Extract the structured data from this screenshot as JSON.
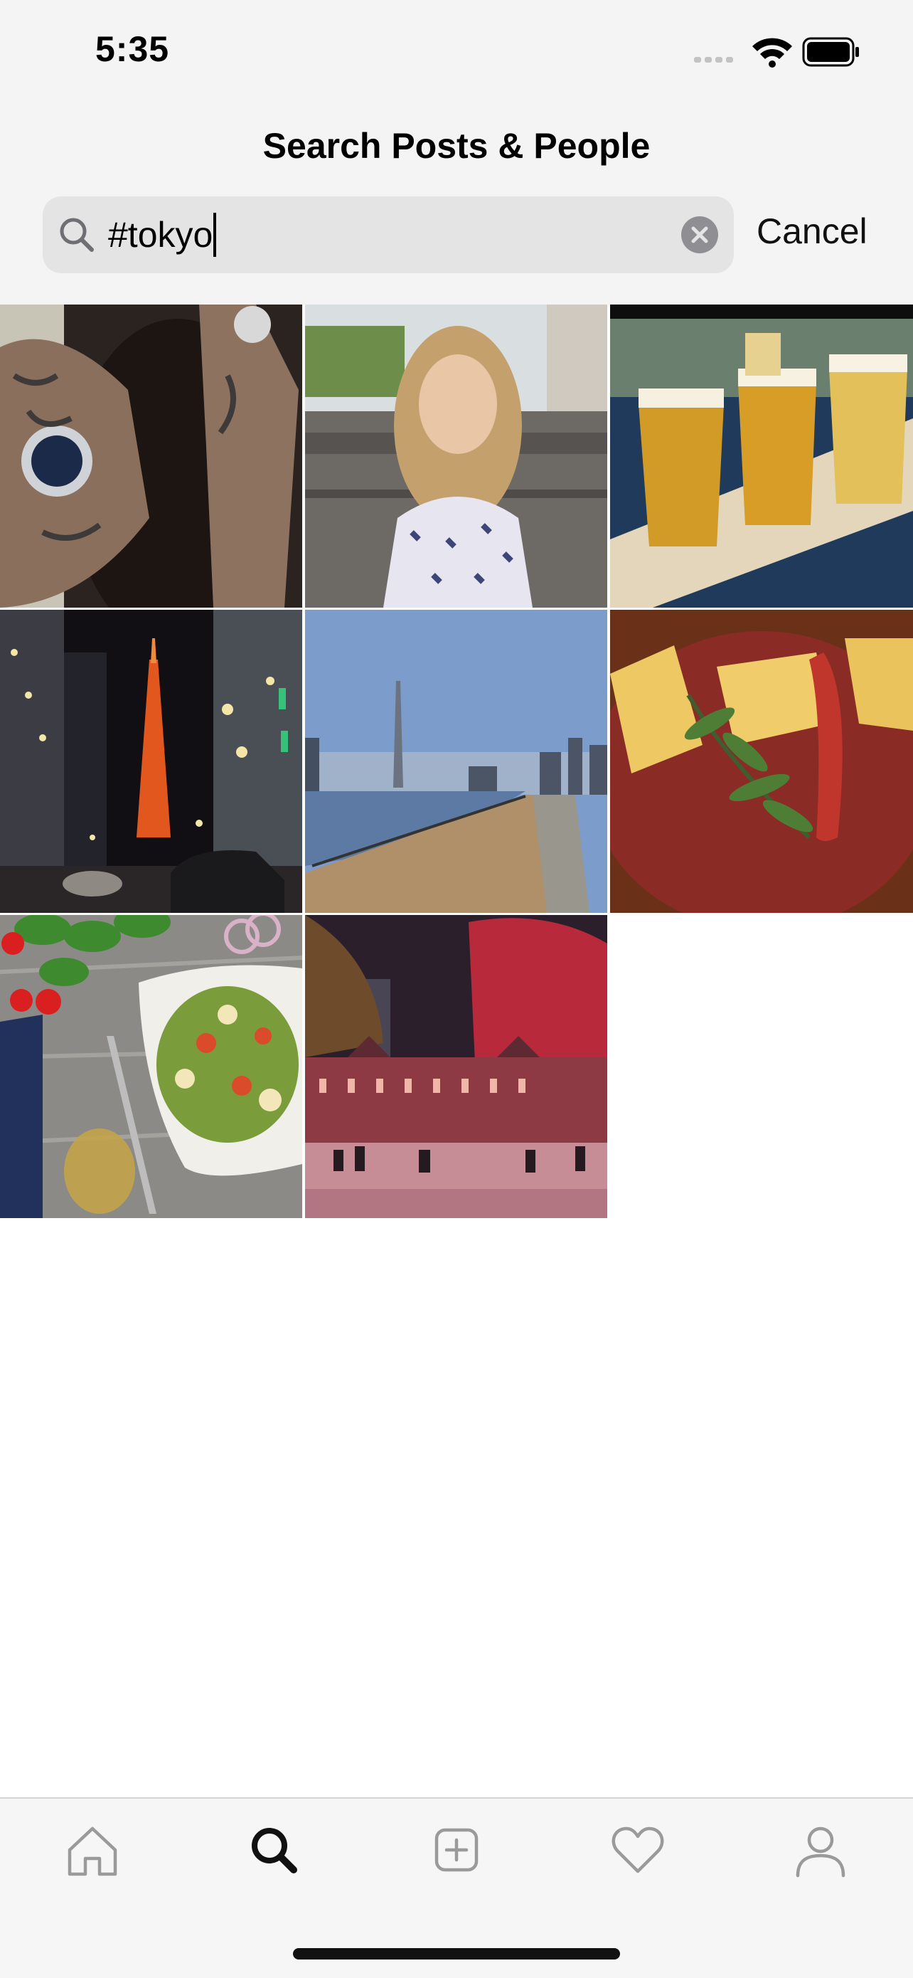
{
  "status_bar": {
    "time": "5:35",
    "signal_icon": "signal-dots-icon",
    "wifi_icon": "wifi-icon",
    "battery_icon": "battery-icon"
  },
  "header": {
    "title": "Search Posts & People"
  },
  "search": {
    "value": "#tokyo",
    "search_icon": "magnifier-icon",
    "clear_icon": "clear-x-icon",
    "cancel_label": "Cancel"
  },
  "results": [
    {
      "name": "post-tattooed-hands-watch"
    },
    {
      "name": "post-blonde-woman-portrait"
    },
    {
      "name": "post-beer-flight"
    },
    {
      "name": "post-tokyo-tower-night-street"
    },
    {
      "name": "post-skytree-river"
    },
    {
      "name": "post-tamagoyaki-plate"
    },
    {
      "name": "post-salad-bowl"
    },
    {
      "name": "post-tokyo-station-illuminated"
    }
  ],
  "tab_bar": {
    "items": [
      {
        "name": "home",
        "icon": "house-icon",
        "active": false
      },
      {
        "name": "search",
        "icon": "magnifier-icon",
        "active": true
      },
      {
        "name": "new-post",
        "icon": "plus-square-icon",
        "active": false
      },
      {
        "name": "activity",
        "icon": "heart-icon",
        "active": false
      },
      {
        "name": "profile",
        "icon": "person-icon",
        "active": false
      }
    ]
  },
  "colors": {
    "header_background": "#f4f4f4",
    "search_field": "#e4e4e4",
    "inactive_icon": "#9a9a9a",
    "active_icon": "#111111"
  }
}
